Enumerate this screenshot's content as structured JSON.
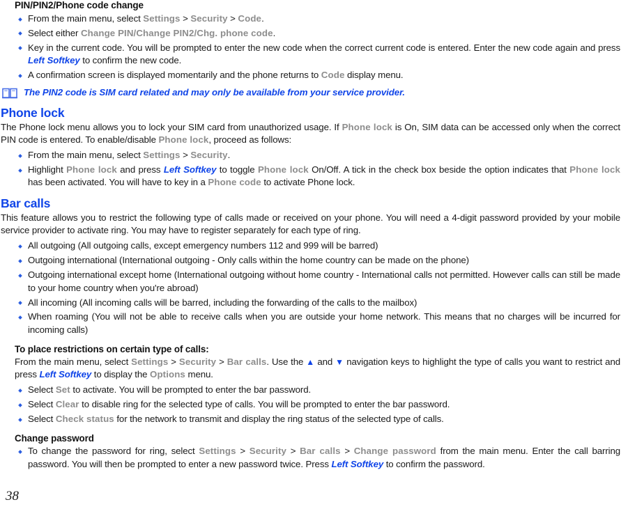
{
  "document": {
    "page_number": "38",
    "accent_color": "#1045e8",
    "ui_term_color": "#8d8d8d"
  },
  "section_pin": {
    "heading": "PIN/PIN2/Phone code change",
    "bullets": {
      "b1": {
        "p1": "From the main menu, select ",
        "ui1": "Settings",
        "sep1": " > ",
        "ui2": "Security",
        "sep2": " > ",
        "ui3": "Code",
        "p2": "."
      },
      "b2": {
        "p1": "Select either ",
        "ui1": "Change PIN/Change PIN2/Chg. phone code",
        "p2": "."
      },
      "b3": {
        "p1": "Key in the current code. You will be prompted to enter the new code when the correct current code is entered. Enter the new code again and press ",
        "key1": "Left Softkey",
        "p2": " to confirm the new code."
      },
      "b4": {
        "p1": "A confirmation screen is displayed momentarily and the phone returns to ",
        "ui1": "Code",
        "p2": " display menu."
      }
    },
    "note": {
      "icon": "book-icon",
      "text": "The PIN2 code is SIM card related and may only be available from your service provider."
    }
  },
  "section_phone_lock": {
    "heading": "Phone lock",
    "intro": {
      "p1": "The Phone lock menu allows you to lock your SIM card from unauthorized usage. If ",
      "ui1": "Phone lock",
      "p2": " is On, SIM data can be accessed only when the correct PIN code is entered. To enable/disable  ",
      "ui2": "Phone lock",
      "p3": ", proceed as follows:"
    },
    "bullets": {
      "b1": {
        "p1": "From the main menu, select ",
        "ui1": "Settings",
        "sep1": " > ",
        "ui2": "Security",
        "p2": "."
      },
      "b2": {
        "p1": "Highlight ",
        "ui1": "Phone lock",
        "p2": " and press ",
        "key1": "Left Softkey",
        "p3": " to toggle ",
        "ui2": "Phone lock",
        "p4": " On/Off. A tick in the check box beside the option indicates that ",
        "ui3": "Phone lock",
        "p5": " has been activated. You will have to key in a ",
        "ui4": "Phone code",
        "p6": "  to activate Phone lock."
      }
    }
  },
  "section_bar_calls": {
    "heading": "Bar calls",
    "intro": "This feature allows you to restrict the following type of calls made or received on your phone. You will need a 4-digit password provided by your mobile service provider to activate ring. You may have to register separately for each type of ring.",
    "call_types": [
      "All outgoing (All outgoing calls, except emergency numbers 112 and 999 will be barred)",
      "Outgoing international (International outgoing - Only calls within the home country can be made on the phone)",
      "Outgoing international except home (International outgoing without home country - International calls not permitted. However calls can still be made to your home country when you're abroad)",
      "All incoming (All incoming calls will be barred, including the forwarding of the calls to the mailbox)",
      "When roaming (You will not be able to receive calls when you are outside your home network. This means that no charges will be incurred for incoming calls)"
    ],
    "restrictions": {
      "lead": "To place restrictions on certain type of calls:",
      "p1": "From the main menu, select ",
      "ui1": "Settings",
      "sep1": " > ",
      "ui2": "Security",
      "sep2": " > ",
      "ui3": "Bar calls",
      "p2": ". Use the ",
      "icon_up": "▲",
      "p3": " and ",
      "icon_down": "▼",
      "p4": " navigation keys to highlight the type of calls you want to restrict and press ",
      "key1": "Left Softkey",
      "p5": " to display the ",
      "ui4": "Options",
      "p6": " menu."
    },
    "options": {
      "o1": {
        "p1": "Select ",
        "ui1": "Set",
        "p2": " to activate. You will be prompted to enter the bar password."
      },
      "o2": {
        "p1": "Select ",
        "ui1": "Clear",
        "p2": " to disable ring for the selected type of calls. You will be prompted to enter the bar password."
      },
      "o3": {
        "p1": "Select ",
        "ui1": "Check status",
        "p2": " for the network to transmit and display the ring status of the selected type of calls."
      }
    },
    "change_password": {
      "heading": "Change password",
      "p1": "To change the password for ring, select ",
      "ui1": "Settings",
      "sep1": " > ",
      "ui2": "Security",
      "sep2": " > ",
      "ui3": "Bar calls",
      "sep3": " > ",
      "ui4": "Change password",
      "p2": " from the main menu. Enter the call barring password. You will then be prompted to enter a new password twice. Press ",
      "key1": "Left Softkey",
      "p3": " to confirm the password."
    }
  }
}
